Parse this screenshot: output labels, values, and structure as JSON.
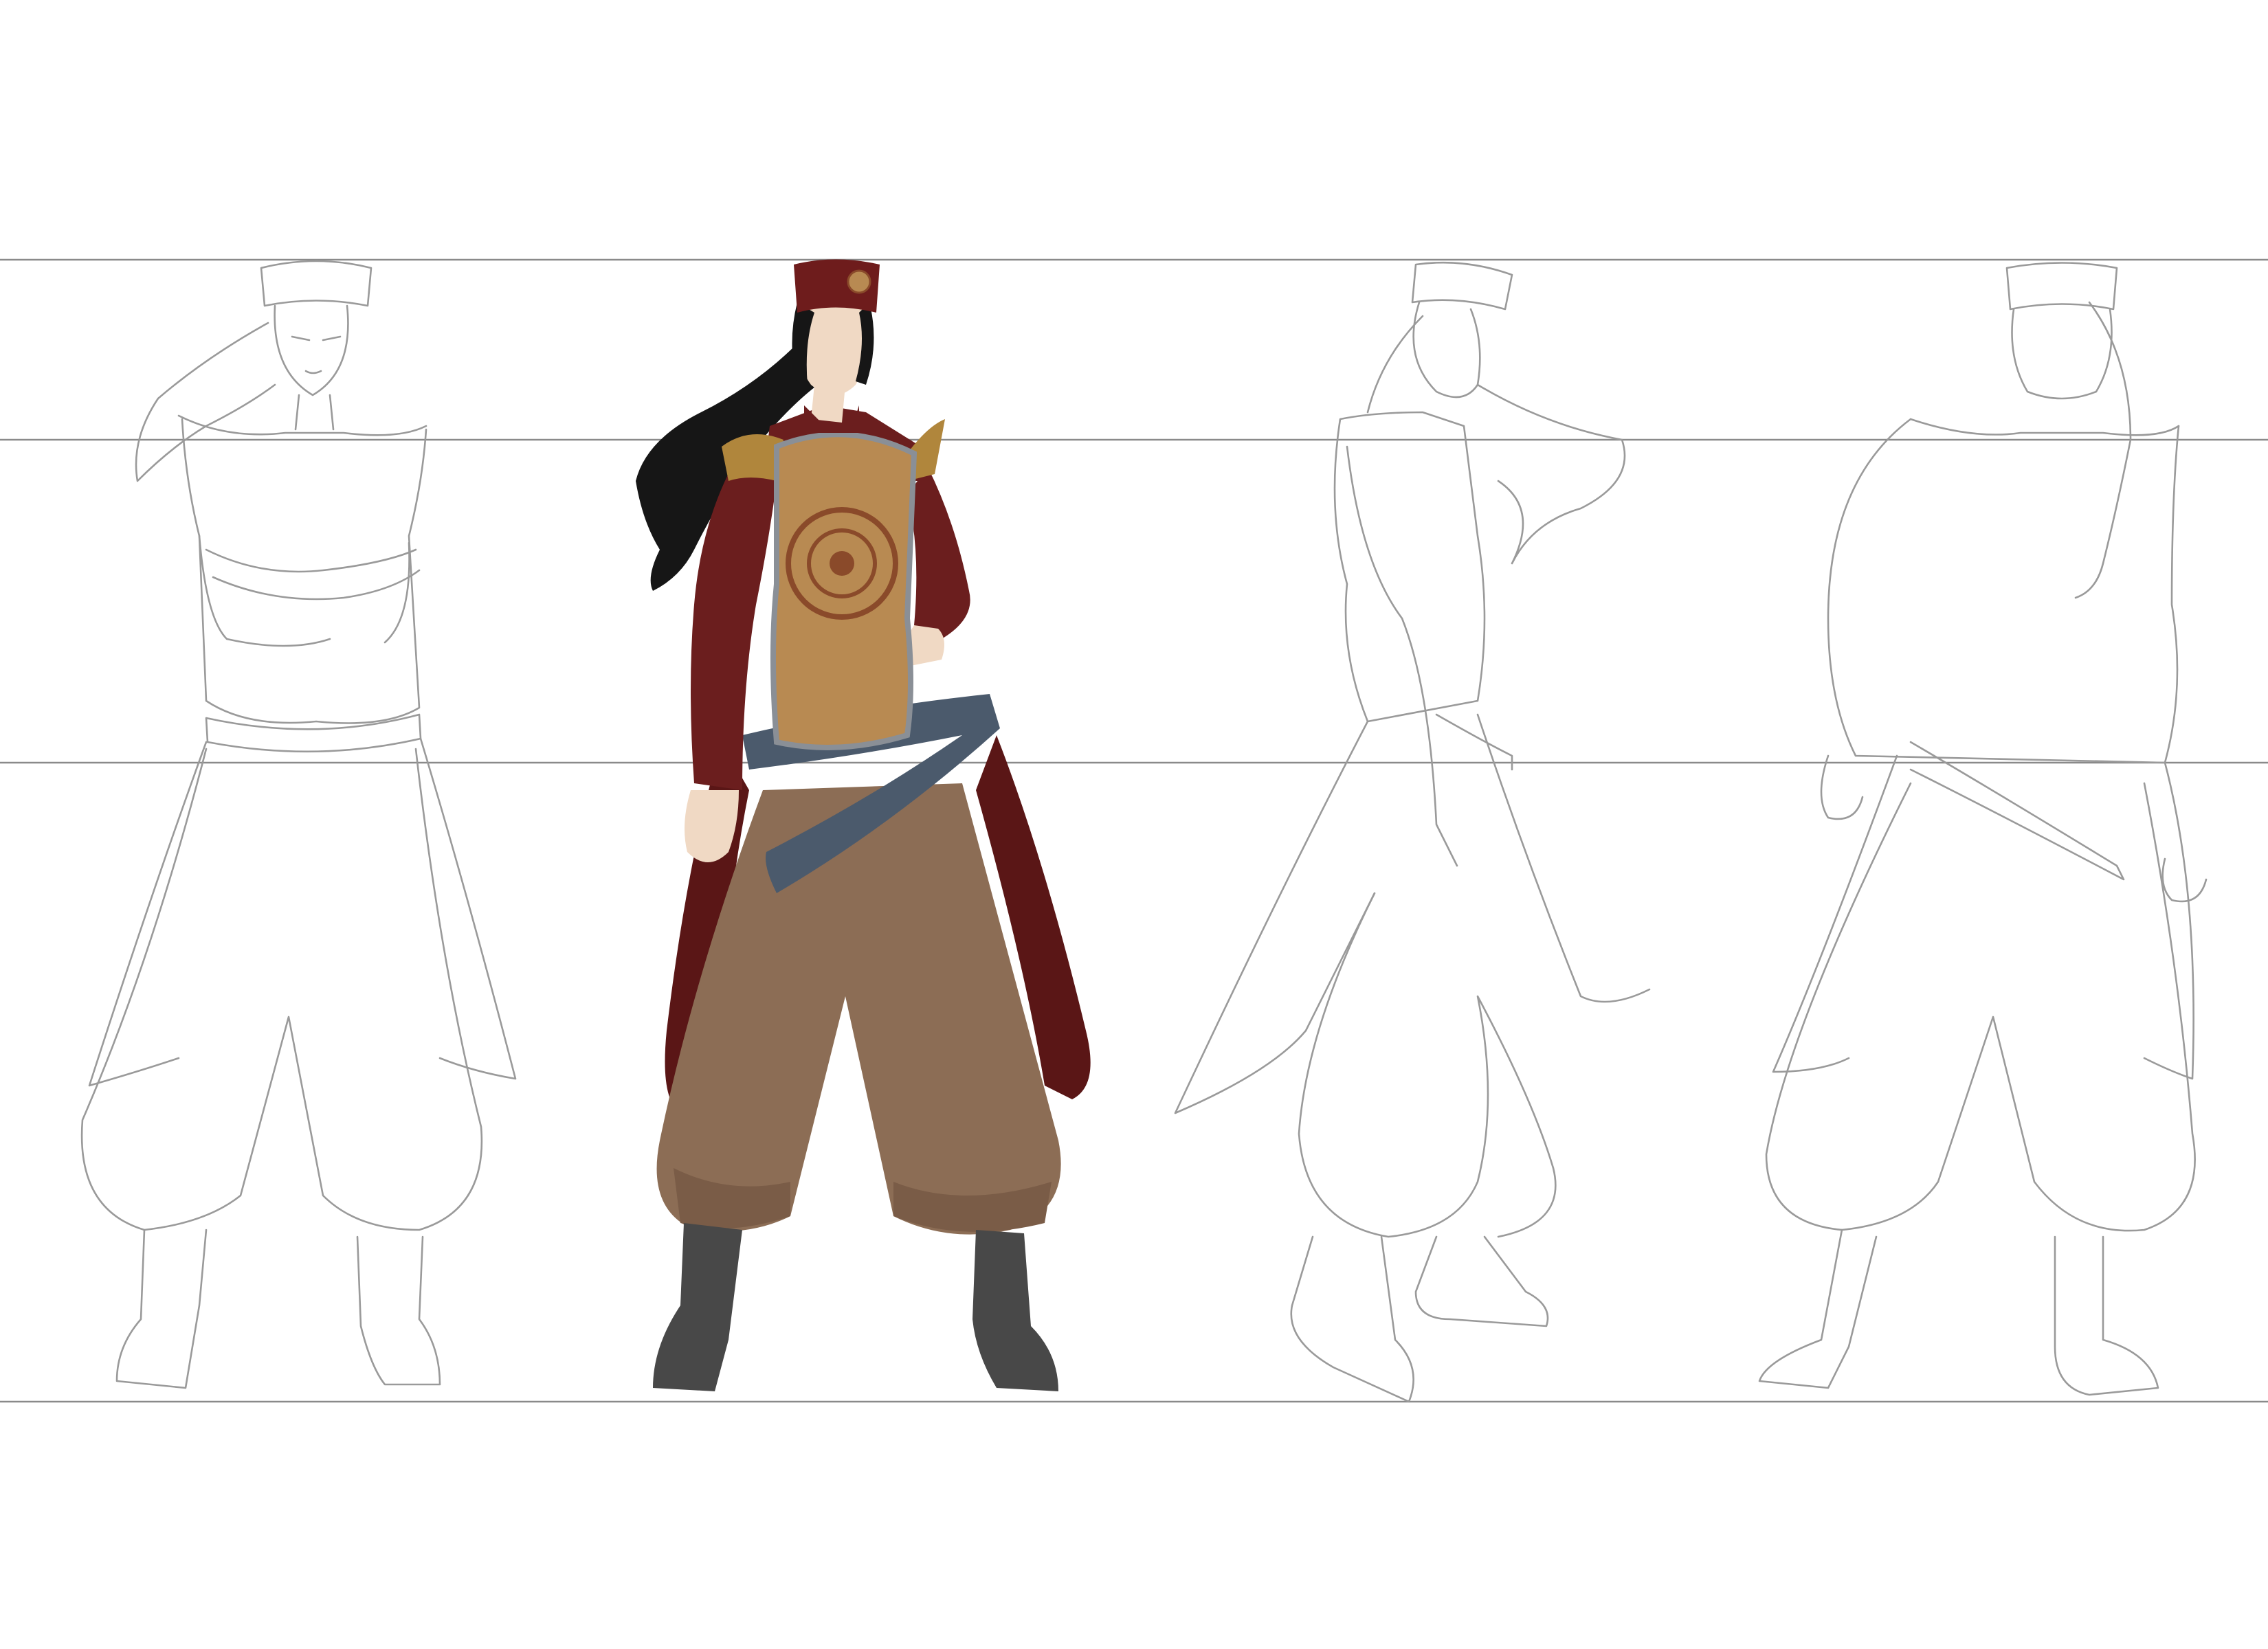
{
  "sheet": {
    "kind": "character-turnaround",
    "background": "#ffffff",
    "guide_line_color": "#8a8a8a",
    "sketch_line_color": "#9a9a9a"
  },
  "views": [
    {
      "name": "front-arms-crossed",
      "style": "line-sketch"
    },
    {
      "name": "three-quarter-hand-on-hip",
      "style": "full-color"
    },
    {
      "name": "side",
      "style": "line-sketch"
    },
    {
      "name": "back",
      "style": "line-sketch"
    }
  ],
  "palette": {
    "hat": "#6e1c1c",
    "tunic": "#6b1e1e",
    "vest": "#b88a52",
    "vest_pattern": "#8a4a2a",
    "shoulder_trim": "#b0863c",
    "collar_trim": "#8a8f96",
    "sash": "#4b5a6c",
    "coat": "#5a1616",
    "trousers": "#8c6d55",
    "boots": "#484848",
    "skin": "#f0d9c4",
    "hair": "#161616"
  }
}
